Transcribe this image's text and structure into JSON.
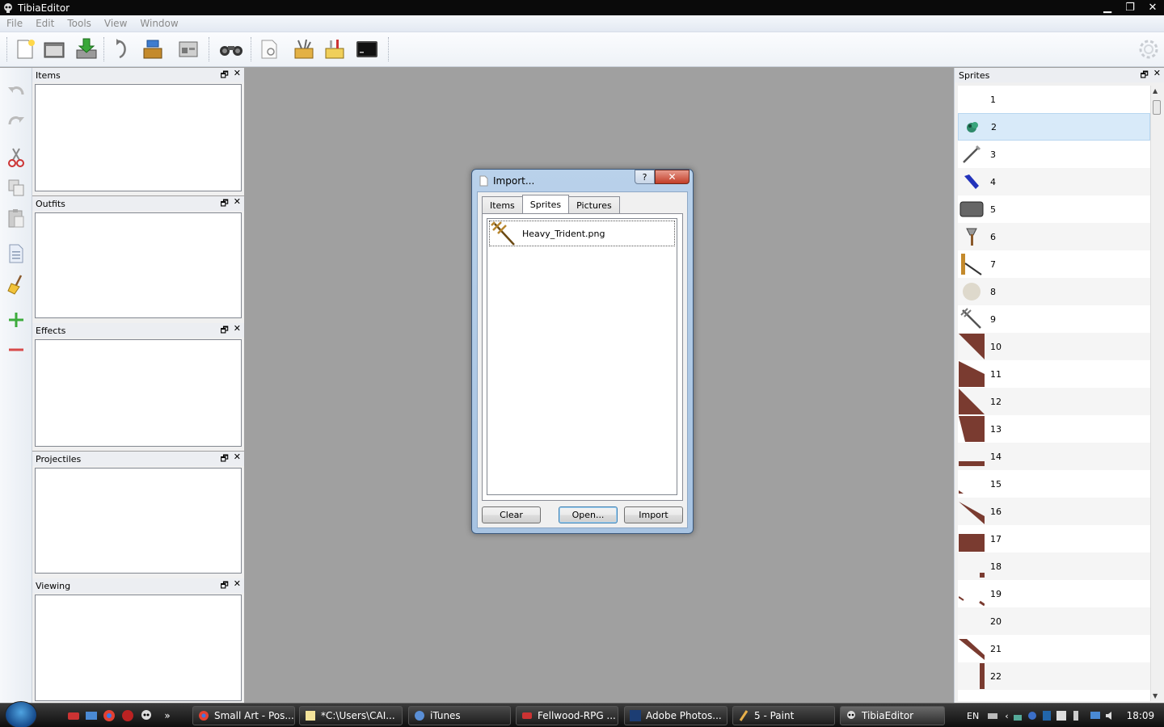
{
  "window": {
    "title": "TibiaEditor"
  },
  "menu": [
    "File",
    "Edit",
    "Tools",
    "View",
    "Window"
  ],
  "toolbar": [
    {
      "name": "new-file-icon"
    },
    {
      "name": "open-folder-icon"
    },
    {
      "name": "compile-download-icon"
    },
    {
      "name": "undo-arrow-icon"
    },
    {
      "name": "import-export-icon"
    },
    {
      "name": "properties-icon"
    },
    {
      "name": "binoculars-icon"
    },
    {
      "name": "page-search-icon"
    },
    {
      "name": "item-editor-icon"
    },
    {
      "name": "sprite-editor-icon"
    },
    {
      "name": "console-icon"
    }
  ],
  "left_toolbar": [
    {
      "name": "undo-icon"
    },
    {
      "name": "redo-icon"
    },
    {
      "name": "cut-icon"
    },
    {
      "name": "copy-icon"
    },
    {
      "name": "paste-icon"
    },
    {
      "name": "document-icon"
    },
    {
      "name": "broom-icon"
    },
    {
      "name": "add-icon"
    },
    {
      "name": "remove-icon"
    }
  ],
  "panels": {
    "items": "Items",
    "outfits": "Outfits",
    "effects": "Effects",
    "projectiles": "Projectiles",
    "viewing": "Viewing",
    "sprites": "Sprites",
    "float_glyph": "🗗",
    "close_glyph": "✕"
  },
  "sprites": [
    "1",
    "2",
    "3",
    "4",
    "5",
    "6",
    "7",
    "8",
    "9",
    "10",
    "11",
    "12",
    "13",
    "14",
    "15",
    "16",
    "17",
    "18",
    "19",
    "20",
    "21",
    "22"
  ],
  "sprite_selected": "2",
  "dialog": {
    "title": "Import...",
    "help": "?",
    "close": "✕",
    "tabs": [
      "Items",
      "Sprites",
      "Pictures"
    ],
    "active_tab": "Sprites",
    "file": "Heavy_Trident.png",
    "buttons": {
      "clear": "Clear",
      "open": "Open...",
      "import": "Import"
    }
  },
  "taskbar": {
    "tasks": [
      "Small Art - Pos...",
      "*C:\\Users\\CAI...",
      "iTunes",
      "Fellwood-RPG ...",
      "Adobe Photos...",
      "5 - Paint",
      "TibiaEditor"
    ],
    "active": "TibiaEditor",
    "overflow": "»",
    "lang": "EN",
    "clock": "18:09"
  },
  "colors": {
    "accent": "#3c7fb1",
    "workspace": "#a0a0a0",
    "title_bar": "#0a0a0a"
  }
}
